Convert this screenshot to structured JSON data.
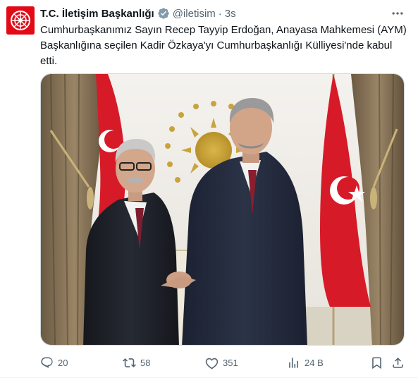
{
  "tweet": {
    "author": {
      "display_name": "T.C. İletişim Başkanlığı",
      "verified_badge": "gray-check-badge-icon",
      "handle": "@iletisim",
      "separator": "·",
      "time": "3s"
    },
    "text": "Cumhurbaşkanımız Sayın Recep Tayyip Erdoğan, Anayasa Mahkemesi (AYM) Başkanlığına seçilen Kadir Özkaya'yı Cumhurbaşkanlığı Külliyesi'nde kabul etti.",
    "media": {
      "icon": "photo"
    },
    "actions": {
      "replies": "20",
      "reposts": "58",
      "likes": "351",
      "views": "24 B"
    }
  },
  "colors": {
    "text": "#0f1419",
    "secondary": "#536471",
    "brand_red": "#e30a17",
    "border": "#cfd9de",
    "verified_gray": "#829aab"
  }
}
